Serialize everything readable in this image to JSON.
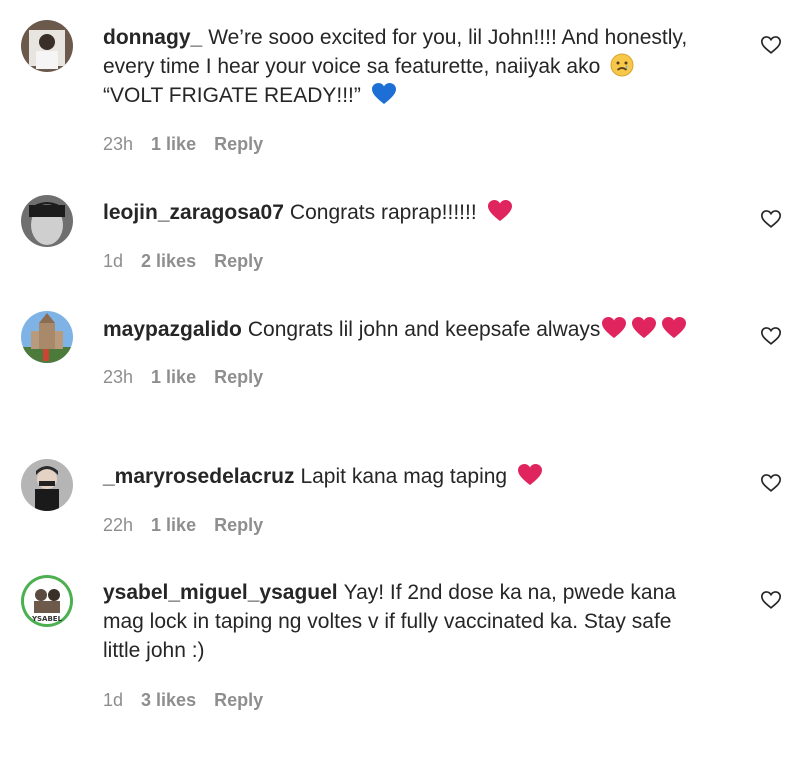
{
  "comments": [
    {
      "username": "donnagy_",
      "text": "We’re sooo excited for you, lil John!!!! And honestly, every time I hear your voice sa featurette, naiiyak ako",
      "text2": "“VOLT FRIGATE READY!!!”",
      "time": "23h",
      "likes": "1 like",
      "reply": "Reply",
      "emojis": [
        "sad-face-emoji",
        "blue-heart-emoji"
      ]
    },
    {
      "username": "leojin_zaragosa07",
      "text": "Congrats raprap!!!!!!",
      "time": "1d",
      "likes": "2 likes",
      "reply": "Reply",
      "emojis": [
        "red-heart-emoji"
      ]
    },
    {
      "username": "maypazgalido",
      "text": "Congrats lil john and keepsafe always",
      "time": "23h",
      "likes": "1 like",
      "reply": "Reply",
      "emojis": [
        "red-heart-emoji",
        "red-heart-emoji",
        "red-heart-emoji"
      ]
    },
    {
      "username": "_maryrosedelacruz",
      "text": "Lapit kana mag taping",
      "time": "22h",
      "likes": "1 like",
      "reply": "Reply",
      "emojis": [
        "red-heart-emoji"
      ]
    },
    {
      "username": "ysabel_miguel_ysaguel",
      "text": "Yay! If 2nd dose ka na, pwede kana mag lock in taping ng voltes v if fully vaccinated ka. Stay safe little john :)",
      "time": "1d",
      "likes": "3 likes",
      "reply": "Reply",
      "avatar_text": "YSABEL"
    }
  ],
  "colors": {
    "text": "#262626",
    "muted": "#8e8e8e",
    "red_heart": "#e0245e",
    "blue_heart": "#1d6fd6"
  }
}
